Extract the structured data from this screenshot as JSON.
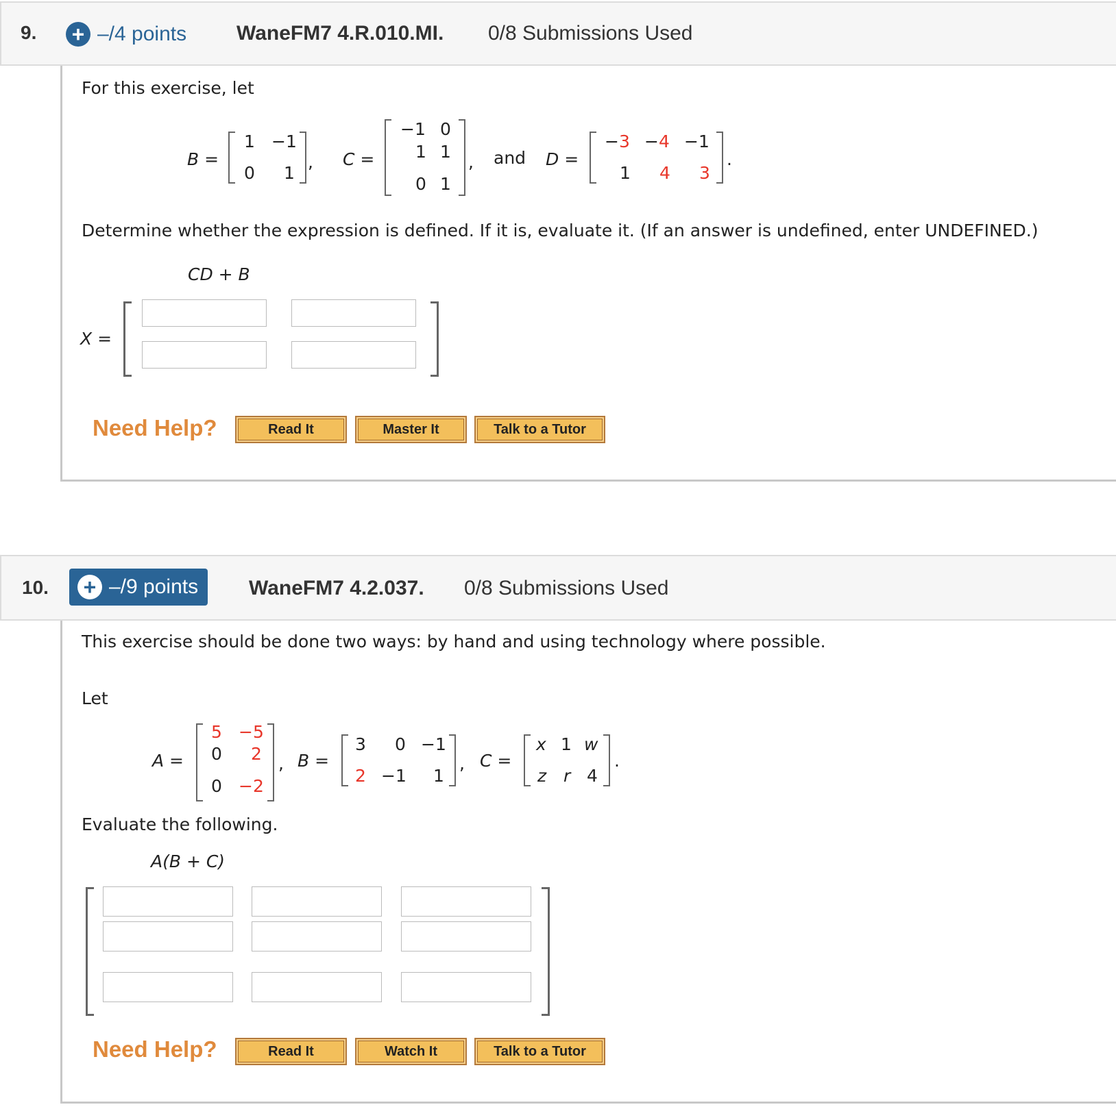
{
  "questions": [
    {
      "number": "9.",
      "points": "–/4 points",
      "id": "WaneFM7 4.R.010.MI.",
      "submissions": "0/8 Submissions Used",
      "intro": "For this exercise, let",
      "matrices": {
        "B": {
          "label": "B =",
          "rows": [
            [
              "1",
              "−1"
            ],
            [
              "0",
              "1"
            ]
          ]
        },
        "C": {
          "label": "C =",
          "rows": [
            [
              "−1",
              "0"
            ],
            [
              "1",
              "1"
            ],
            [
              "0",
              "1"
            ]
          ]
        },
        "and": "and",
        "D": {
          "label": "D =",
          "rows": [
            [
              "−3",
              "−4",
              "−1"
            ],
            [
              "1",
              "4",
              "3"
            ]
          ]
        }
      },
      "instruction": "Determine whether the expression is defined. If it is, evaluate it. (If an answer is undefined, enter UNDEFINED.)",
      "expression": "CD + B",
      "answer_label": "X =",
      "answers": [
        [
          "",
          ""
        ],
        [
          "",
          ""
        ]
      ],
      "help_label": "Need Help?",
      "help_buttons": [
        "Read It",
        "Master It",
        "Talk to a Tutor"
      ]
    },
    {
      "number": "10.",
      "points": "–/9 points",
      "id": "WaneFM7 4.2.037.",
      "submissions": "0/8 Submissions Used",
      "intro": "This exercise should be done two ways: by hand and using technology where possible.",
      "let": "Let",
      "matrices": {
        "A": {
          "label": "A =",
          "rows": [
            [
              "5",
              "−5"
            ],
            [
              "0",
              "2"
            ],
            [
              "0",
              "−2"
            ]
          ]
        },
        "B": {
          "label": "B =",
          "rows": [
            [
              "3",
              "0",
              "−1"
            ],
            [
              "2",
              "−1",
              "1"
            ]
          ]
        },
        "C": {
          "label": "C =",
          "rows": [
            [
              "x",
              "1",
              "w"
            ],
            [
              "z",
              "r",
              "4"
            ]
          ]
        }
      },
      "instruction": "Evaluate the following.",
      "expression": "A(B + C)",
      "answers": [
        [
          "",
          "",
          ""
        ],
        [
          "",
          "",
          ""
        ],
        [
          "",
          "",
          ""
        ]
      ],
      "help_label": "Need Help?",
      "help_buttons": [
        "Read It",
        "Watch It",
        "Talk to a Tutor"
      ]
    }
  ],
  "colors": {
    "accent_blue": "#2a6496",
    "highlight_red": "#e8362a",
    "help_orange": "#e08a3c",
    "button_fill": "#f3bf5b"
  }
}
